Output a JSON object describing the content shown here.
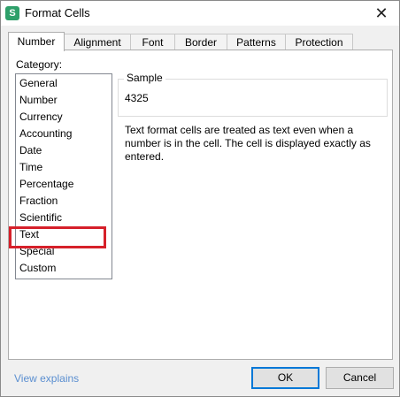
{
  "window": {
    "title": "Format Cells",
    "app_icon_glyph": "S",
    "close_glyph": "✕"
  },
  "tabs": [
    {
      "label": "Number",
      "active": true
    },
    {
      "label": "Alignment",
      "active": false
    },
    {
      "label": "Font",
      "active": false
    },
    {
      "label": "Border",
      "active": false
    },
    {
      "label": "Patterns",
      "active": false
    },
    {
      "label": "Protection",
      "active": false
    }
  ],
  "category": {
    "label": "Category:",
    "items": [
      "General",
      "Number",
      "Currency",
      "Accounting",
      "Date",
      "Time",
      "Percentage",
      "Fraction",
      "Scientific",
      "Text",
      "Special",
      "Custom"
    ],
    "selected": "Text"
  },
  "sample": {
    "legend": "Sample",
    "value": "4325"
  },
  "description": "Text format cells are treated as text even when a number is in the cell. The cell is displayed exactly as entered.",
  "footer": {
    "link": "View explains",
    "ok_label": "OK",
    "cancel_label": "Cancel"
  },
  "colors": {
    "highlight": "#d6202a",
    "link": "#5b8fd0",
    "app_icon": "#2ea06a"
  }
}
